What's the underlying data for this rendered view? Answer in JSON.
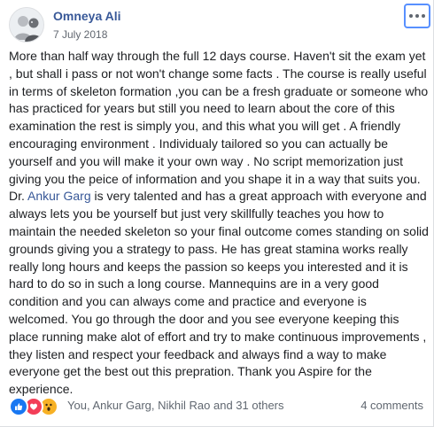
{
  "post": {
    "author": "Omneya Ali",
    "date": "7 July 2018",
    "more_icon": "more-options-icon",
    "avatar_icon": "profile-photo",
    "text_before_mention": "More than half way through the full 12 days course. Haven't sit the exam yet , but shall i pass or not won't change some facts . The course is really useful in terms of skeleton formation ,you can be a fresh graduate or someone who has practiced for years but still you need to learn about the core of this examination the rest is simply you, and this what you will get . A friendly encouraging environment . Individualy tailored so you can actually be yourself and you will make it your own way . No script memorization just giving you the peice of information and you shape it in a way that suits you. Dr. ",
    "mention": "Ankur Garg",
    "text_after_mention": " is very talented and has a great approach with everyone and always lets you be yourself but just very skillfully teaches you how to maintain the needed skeleton so your final outcome comes standing on solid grounds giving you a strategy to pass. He has great stamina works really really long hours and keeps the passion so keeps you interested and it is hard to do so in such a long course. Mannequins are in a very good condition and you can always come and practice and everyone is welcomed. You go through the door and you see everyone keeping this place running make alot of effort and try to make continuous improvements , they listen and respect your feedback and always find a way to make everyone get the best out this prepration. Thank you Aspire for the experience."
  },
  "footer": {
    "reactions": [
      "like-icon",
      "love-icon",
      "wow-icon"
    ],
    "reactors_text": "You, Ankur Garg, Nikhil Rao and 31 others",
    "comments_text": "4 comments"
  },
  "colors": {
    "link": "#385898",
    "like": "#1877f2",
    "love": "#f33e58",
    "wow": "#f7b125",
    "focus": "#5890ff"
  }
}
